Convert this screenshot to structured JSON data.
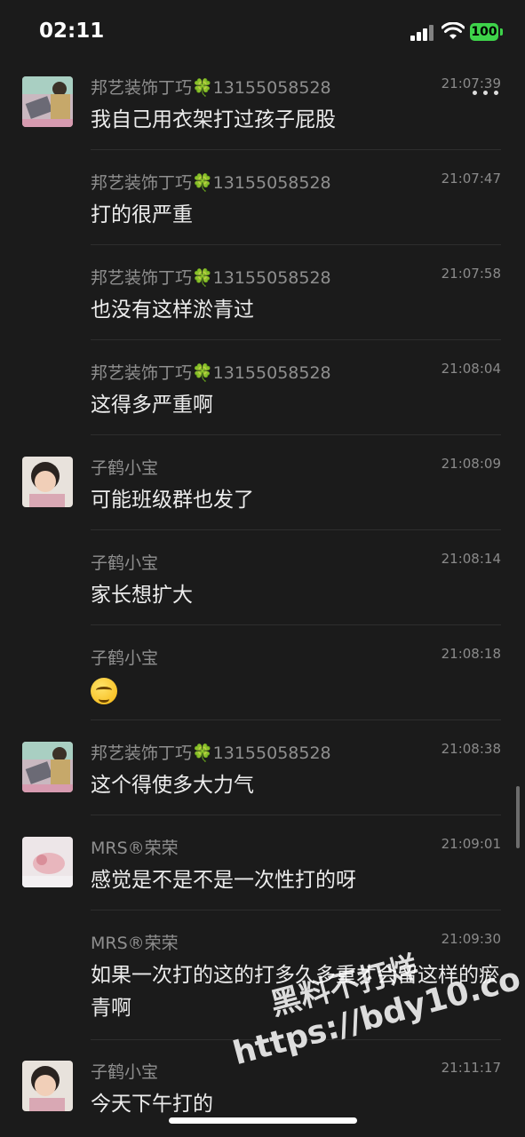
{
  "status_bar": {
    "time": "02:11",
    "battery": "100"
  },
  "messages": [
    {
      "sender": "邦艺装饰丁巧🍀13155058528",
      "time": "21:07:39",
      "text": "我自己用衣架打过孩子屁股"
    },
    {
      "sender": "邦艺装饰丁巧🍀13155058528",
      "time": "21:07:47",
      "text": "打的很严重"
    },
    {
      "sender": "邦艺装饰丁巧🍀13155058528",
      "time": "21:07:58",
      "text": "也没有这样淤青过"
    },
    {
      "sender": "邦艺装饰丁巧🍀13155058528",
      "time": "21:08:04",
      "text": "这得多严重啊"
    },
    {
      "sender": "子鹤小宝",
      "time": "21:08:09",
      "text": "可能班级群也发了"
    },
    {
      "sender": "子鹤小宝",
      "time": "21:08:14",
      "text": "家长想扩大"
    },
    {
      "sender": "子鹤小宝",
      "time": "21:08:18",
      "text": ""
    },
    {
      "sender": "邦艺装饰丁巧🍀13155058528",
      "time": "21:08:38",
      "text": "这个得使多大力气"
    },
    {
      "sender": "MRS®荣荣",
      "time": "21:09:01",
      "text": "感觉是不是不是一次性打的呀"
    },
    {
      "sender": "MRS®荣荣",
      "time": "21:09:30",
      "text": "如果一次打的这的打多久多重才会留这样的瘀青啊"
    },
    {
      "sender": "子鹤小宝",
      "time": "21:11:17",
      "text": "今天下午打的"
    }
  ],
  "watermark": {
    "line1": "黑料不打烊",
    "line2": "https://bdy10.co"
  },
  "icons": {
    "clover": "clover-icon",
    "emoji": "sweat-smile-emoji-icon",
    "menu": "more-dots-icon"
  },
  "colors": {
    "background": "#1b1b1b",
    "battery": "#3ed34a",
    "sender": "#8f8f8f"
  }
}
